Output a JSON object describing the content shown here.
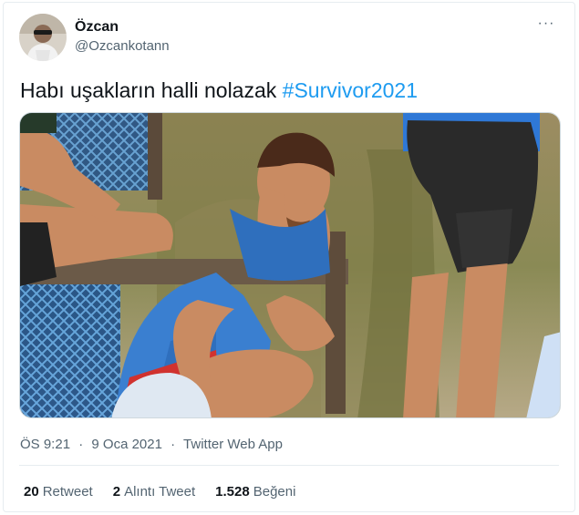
{
  "author": {
    "display_name": "Özcan",
    "handle": "@Ozcankotann",
    "avatar_icon": "profile-photo"
  },
  "tweet": {
    "text": "Habı uşakların halli nolazak ",
    "hashtag": "#Survivor2021"
  },
  "meta": {
    "time": "ÖS 9:21",
    "separator": "·",
    "date": "9 Oca 2021",
    "source": "Twitter Web App"
  },
  "stats": [
    {
      "count": "20",
      "label": "Retweet"
    },
    {
      "count": "2",
      "label": "Alıntı Tweet"
    },
    {
      "count": "1.528",
      "label": "Beğeni"
    }
  ],
  "more_icon": "···",
  "colors": {
    "link": "#1d9bf0",
    "text": "#0f1419",
    "muted": "#536471"
  }
}
